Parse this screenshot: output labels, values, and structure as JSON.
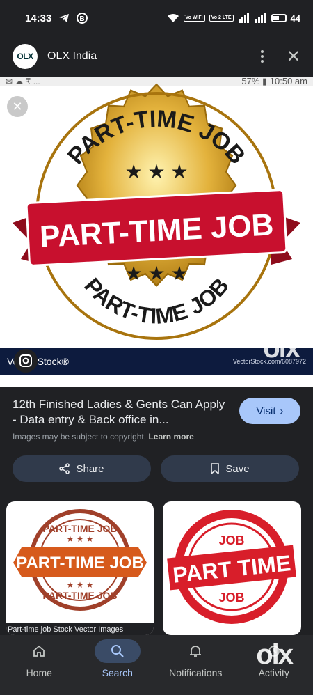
{
  "status_bar": {
    "time": "14:33",
    "battery": "44",
    "net1": "Vo WiFi",
    "net2": "Vo 2 LTE"
  },
  "header": {
    "logo_text": "OLX",
    "app_title": "OLX India"
  },
  "hero": {
    "top_left": "✉ ☁ ₹ ...",
    "top_right": "57% ▮ 10:50 am",
    "bottom_left": "Vector Stock®",
    "bottom_right": "VectorStock.com/6087972",
    "watermark": "olx",
    "badge_text": "PART-TIME JOB",
    "badge_center": "PART-TIME JOB"
  },
  "info": {
    "title": "12th Finished Ladies & Gents Can Apply - Data entry & Back office in...",
    "visit_label": "Visit",
    "copyright_text": "Images may be subject to copyright.",
    "learn_more": "Learn more",
    "share_label": "Share",
    "save_label": "Save"
  },
  "related": [
    {
      "text": "PART-TIME JOB",
      "caption": "Part-time job Stock Vector Images"
    },
    {
      "text": "PART TIME",
      "sub": "JOB",
      "caption": ""
    }
  ],
  "bottom_nav": {
    "items": [
      {
        "label": "Home",
        "icon": "home-icon"
      },
      {
        "label": "Search",
        "icon": "search-icon"
      },
      {
        "label": "Notifications",
        "icon": "bell-icon"
      },
      {
        "label": "Activity",
        "icon": "activity-icon"
      }
    ],
    "active": "Search",
    "watermark": "olx"
  },
  "colors": {
    "background": "#202124",
    "accent": "#a8c7fa",
    "pill": "#303a4b",
    "badge_red": "#c8102e",
    "badge_gold": "#d4a21a"
  }
}
